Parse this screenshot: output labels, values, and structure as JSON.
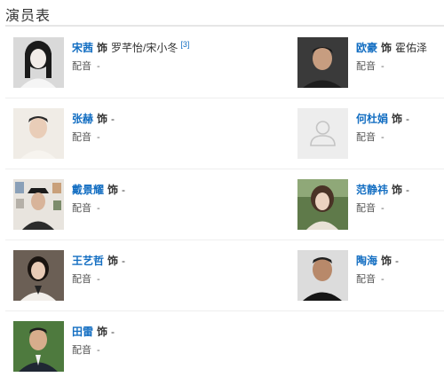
{
  "section": {
    "title": "演员表"
  },
  "cast": [
    {
      "actor": "宋茜",
      "role_prefix": "饰",
      "role": "罗芊怡/宋小冬",
      "cite": "[3]",
      "voice_label": "配音",
      "voice": "-"
    },
    {
      "actor": "欧豪",
      "role_prefix": "饰",
      "role": "霍佑泽",
      "cite": "",
      "voice_label": "配音",
      "voice": "-"
    },
    {
      "actor": "张赫",
      "role_prefix": "饰",
      "role": "-",
      "cite": "",
      "voice_label": "配音",
      "voice": "-"
    },
    {
      "actor": "何杜娟",
      "role_prefix": "饰",
      "role": "-",
      "cite": "",
      "voice_label": "配音",
      "voice": "-"
    },
    {
      "actor": "戴景耀",
      "role_prefix": "饰",
      "role": "-",
      "cite": "",
      "voice_label": "配音",
      "voice": "-"
    },
    {
      "actor": "范静祎",
      "role_prefix": "饰",
      "role": "-",
      "cite": "",
      "voice_label": "配音",
      "voice": "-"
    },
    {
      "actor": "王艺哲",
      "role_prefix": "饰",
      "role": "-",
      "cite": "",
      "voice_label": "配音",
      "voice": "-"
    },
    {
      "actor": "陶海",
      "role_prefix": "饰",
      "role": "-",
      "cite": "",
      "voice_label": "配音",
      "voice": "-"
    },
    {
      "actor": "田雷",
      "role_prefix": "饰",
      "role": "-",
      "cite": "",
      "voice_label": "配音",
      "voice": "-"
    }
  ],
  "colors": {
    "link": "#136ec2",
    "text": "#333333",
    "rule": "#e6e6e6"
  }
}
